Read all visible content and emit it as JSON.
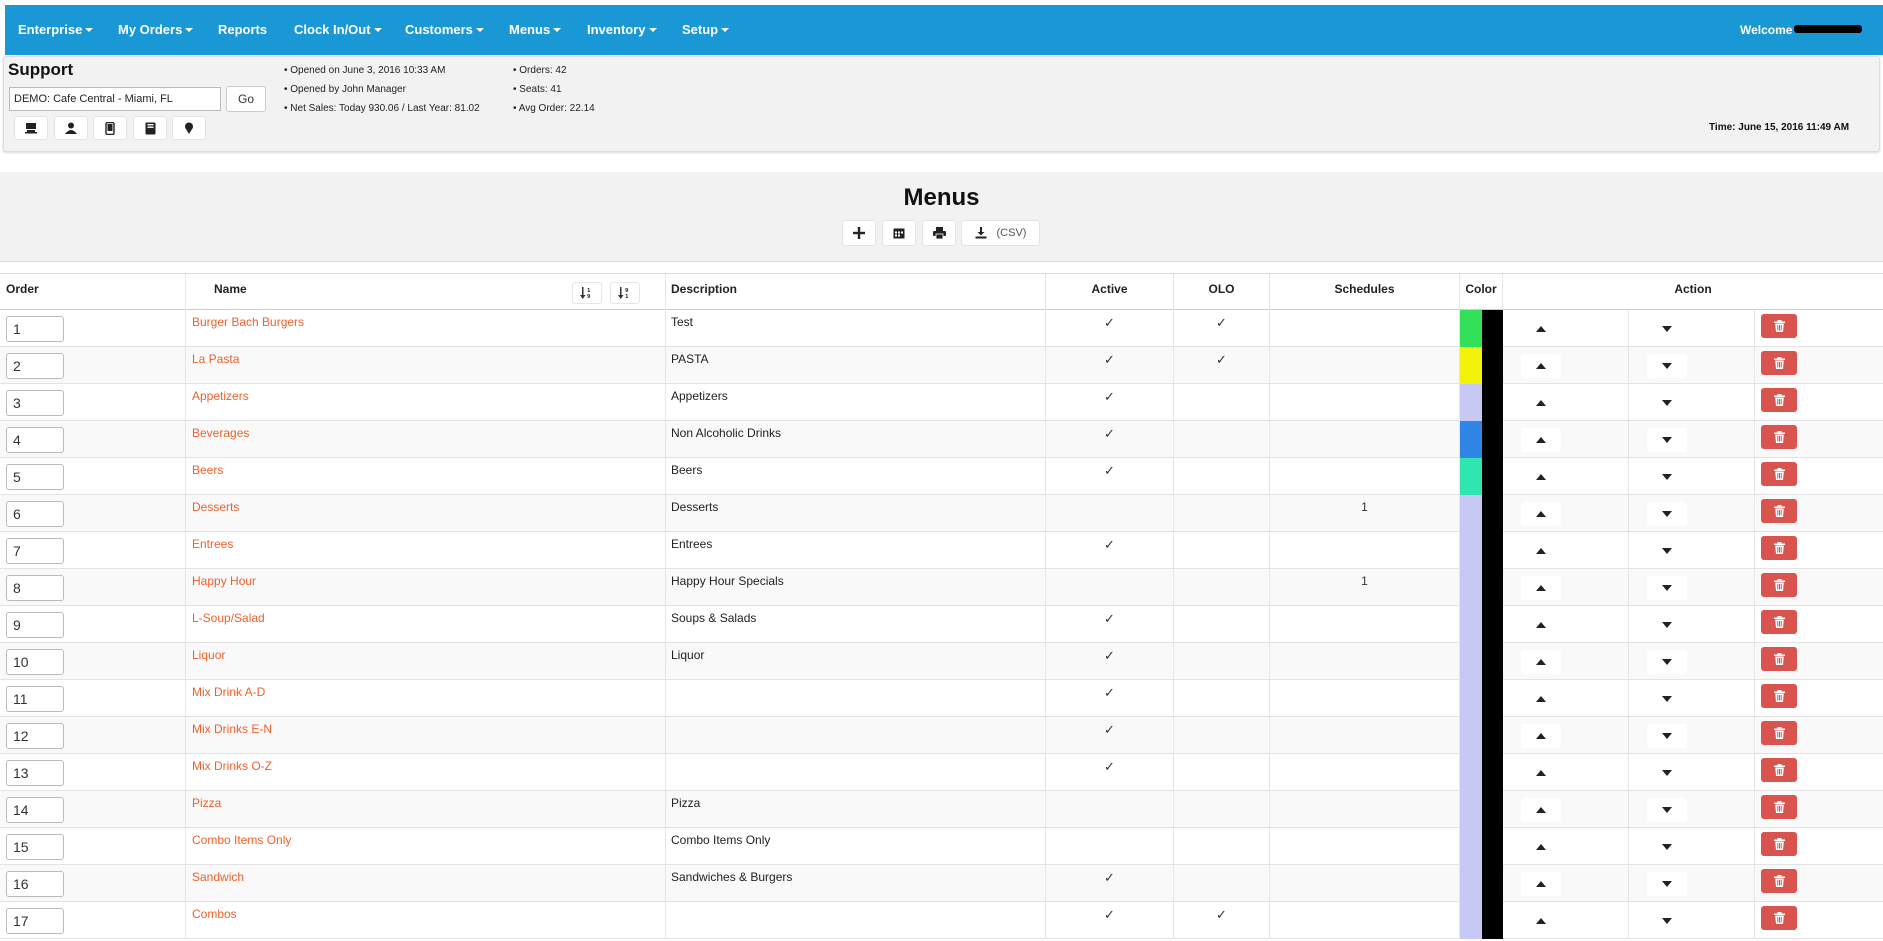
{
  "nav": {
    "items": [
      {
        "label": "Enterprise",
        "dropdown": true
      },
      {
        "label": "My Orders",
        "dropdown": true
      },
      {
        "label": "Reports",
        "dropdown": false
      },
      {
        "label": "Clock In/Out",
        "dropdown": true
      },
      {
        "label": "Customers",
        "dropdown": true
      },
      {
        "label": "Menus",
        "dropdown": true
      },
      {
        "label": "Inventory",
        "dropdown": true
      },
      {
        "label": "Setup",
        "dropdown": true
      }
    ],
    "welcome": "Welcome"
  },
  "support": {
    "title": "Support",
    "location_value": "DEMO: Cafe Central - Miami, FL",
    "go_label": "Go",
    "icons": [
      "register-icon",
      "user-icon",
      "mobile-icon",
      "book-icon",
      "pin-icon"
    ],
    "info_left": [
      "• Opened on June 3, 2016 10:33 AM",
      "• Opened by John Manager",
      "• Net Sales:  Today 930.06 / Last Year: 81.02"
    ],
    "info_right": [
      "• Orders: 42",
      "• Seats: 41",
      "• Avg Order: 22.14"
    ],
    "time": "Time: June 15, 2016 11:49 AM"
  },
  "page": {
    "title": "Menus",
    "toolbar": {
      "add_icon": "plus-icon",
      "schedule_icon": "calendar-icon",
      "print_icon": "print-icon",
      "csv_icon": "download-icon",
      "csv_label": "(CSV)"
    }
  },
  "table": {
    "headers": {
      "order": "Order",
      "name": "Name",
      "description": "Description",
      "active": "Active",
      "olo": "OLO",
      "schedules": "Schedules",
      "color": "Color",
      "action": "Action"
    },
    "check_glyph": "✓",
    "rows": [
      {
        "order": "1",
        "name": "Burger Bach Burgers",
        "description": "Test",
        "active": true,
        "olo": true,
        "schedules": "",
        "color": "#33e05a"
      },
      {
        "order": "2",
        "name": "La Pasta",
        "description": "PASTA",
        "active": true,
        "olo": true,
        "schedules": "",
        "color": "#f2f20a"
      },
      {
        "order": "3",
        "name": "Appetizers",
        "description": "Appetizers",
        "active": true,
        "olo": false,
        "schedules": "",
        "color": "#c8c8f5"
      },
      {
        "order": "4",
        "name": "Beverages",
        "description": "Non Alcoholic Drinks",
        "active": true,
        "olo": false,
        "schedules": "",
        "color": "#2f86e6"
      },
      {
        "order": "5",
        "name": "Beers",
        "description": "Beers",
        "active": true,
        "olo": false,
        "schedules": "",
        "color": "#2fe6b0"
      },
      {
        "order": "6",
        "name": "Desserts",
        "description": "Desserts",
        "active": false,
        "olo": false,
        "schedules": "1",
        "color": "#c8c8f5"
      },
      {
        "order": "7",
        "name": "Entrees",
        "description": "Entrees",
        "active": true,
        "olo": false,
        "schedules": "",
        "color": "#c8c8f5"
      },
      {
        "order": "8",
        "name": "Happy Hour",
        "description": "Happy Hour Specials",
        "active": false,
        "olo": false,
        "schedules": "1",
        "color": "#c8c8f5"
      },
      {
        "order": "9",
        "name": "L-Soup/Salad",
        "description": "Soups & Salads",
        "active": true,
        "olo": false,
        "schedules": "",
        "color": "#c8c8f5"
      },
      {
        "order": "10",
        "name": "Liquor",
        "description": "Liquor",
        "active": true,
        "olo": false,
        "schedules": "",
        "color": "#c8c8f5"
      },
      {
        "order": "11",
        "name": "Mix Drink A-D",
        "description": "",
        "active": true,
        "olo": false,
        "schedules": "",
        "color": "#c8c8f5"
      },
      {
        "order": "12",
        "name": "Mix Drinks E-N",
        "description": "",
        "active": true,
        "olo": false,
        "schedules": "",
        "color": "#c8c8f5"
      },
      {
        "order": "13",
        "name": "Mix Drinks O-Z",
        "description": "",
        "active": true,
        "olo": false,
        "schedules": "",
        "color": "#c8c8f5"
      },
      {
        "order": "14",
        "name": "Pizza",
        "description": "Pizza",
        "active": false,
        "olo": false,
        "schedules": "",
        "color": "#c8c8f5"
      },
      {
        "order": "15",
        "name": "Combo Items Only",
        "description": "Combo Items Only",
        "active": false,
        "olo": false,
        "schedules": "",
        "color": "#c8c8f5"
      },
      {
        "order": "16",
        "name": "Sandwich",
        "description": "Sandwiches & Burgers",
        "active": true,
        "olo": false,
        "schedules": "",
        "color": "#c8c8f5"
      },
      {
        "order": "17",
        "name": "Combos",
        "description": "",
        "active": true,
        "olo": true,
        "schedules": "",
        "color": "#c8c8f5"
      }
    ]
  }
}
